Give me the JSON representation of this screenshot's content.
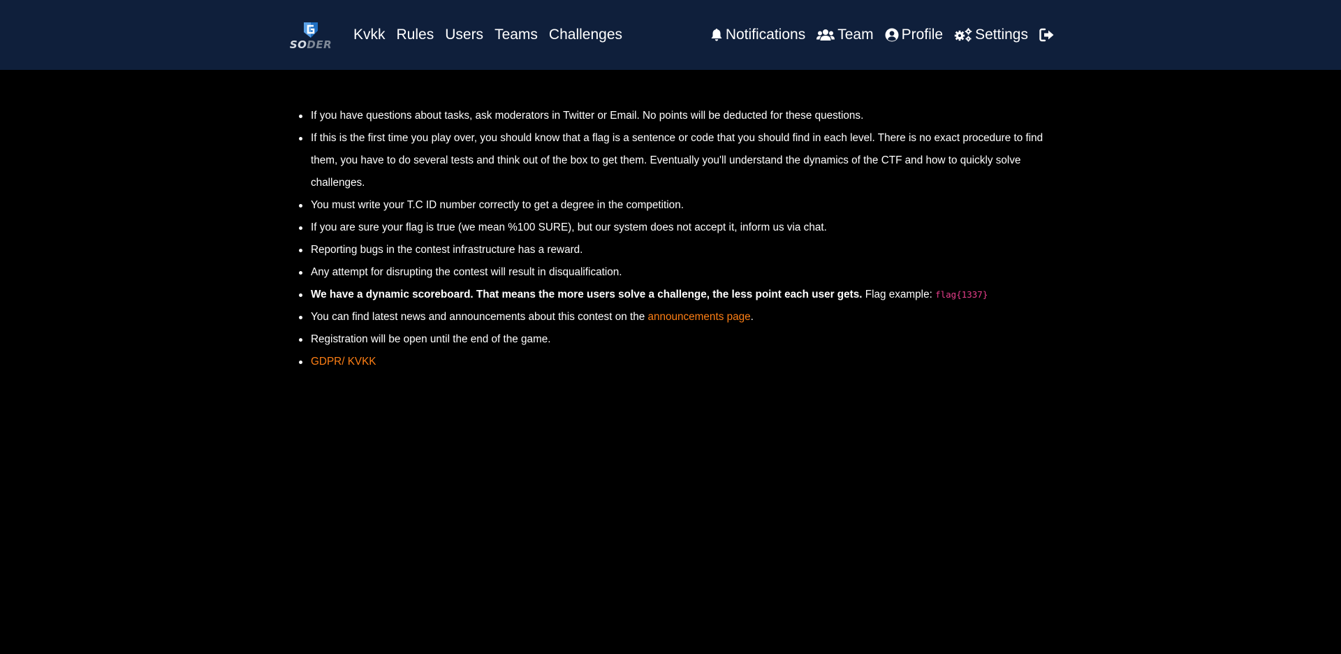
{
  "brand": {
    "logo_text_a": "SO",
    "logo_text_b": "DER"
  },
  "nav": {
    "left": [
      {
        "label": "Kvkk"
      },
      {
        "label": "Rules"
      },
      {
        "label": "Users"
      },
      {
        "label": "Teams"
      },
      {
        "label": "Challenges"
      }
    ],
    "right": [
      {
        "label": "Notifications",
        "icon": "bell-icon"
      },
      {
        "label": "Team",
        "icon": "users-icon"
      },
      {
        "label": "Profile",
        "icon": "user-circle-icon"
      },
      {
        "label": "Settings",
        "icon": "gears-icon"
      },
      {
        "label": "",
        "icon": "logout-icon"
      }
    ]
  },
  "rules": {
    "r1": "If you have questions about tasks, ask moderators in Twitter or Email. No points will be deducted for these questions.",
    "r2": "If this is the first time you play over, you should know that a flag is a sentence or code that you should find in each level. There is no exact procedure to find them, you have to do several tests and think out of the box to get them. Eventually you'll understand the dynamics of the CTF and how to quickly solve challenges.",
    "r3": "You must write your T.C ID number correctly to get a degree in the competition.",
    "r4": "If you are sure your flag is true (we mean %100 SURE), but our system does not accept it, inform us via chat.",
    "r5": "Reporting bugs in the contest infrastructure has a reward.",
    "r6": "Any attempt for disrupting the contest will result in disqualification.",
    "r7_bold": "We have a dynamic scoreboard. That means the more users solve a challenge, the less point each user gets.",
    "r7_text": " Flag example: ",
    "r7_code": "flag{1337}",
    "r8_text": "You can find latest news and announcements about this contest on the ",
    "r8_link": "announcements page",
    "r8_end": ".",
    "r9": "Registration will be open until the end of the game.",
    "r10_link": "GDPR/ KVKK"
  },
  "colors": {
    "navbar": "#0f1f3b",
    "background": "#000000",
    "link_orange": "#fd7e14",
    "code_pink": "#e83e8c"
  }
}
